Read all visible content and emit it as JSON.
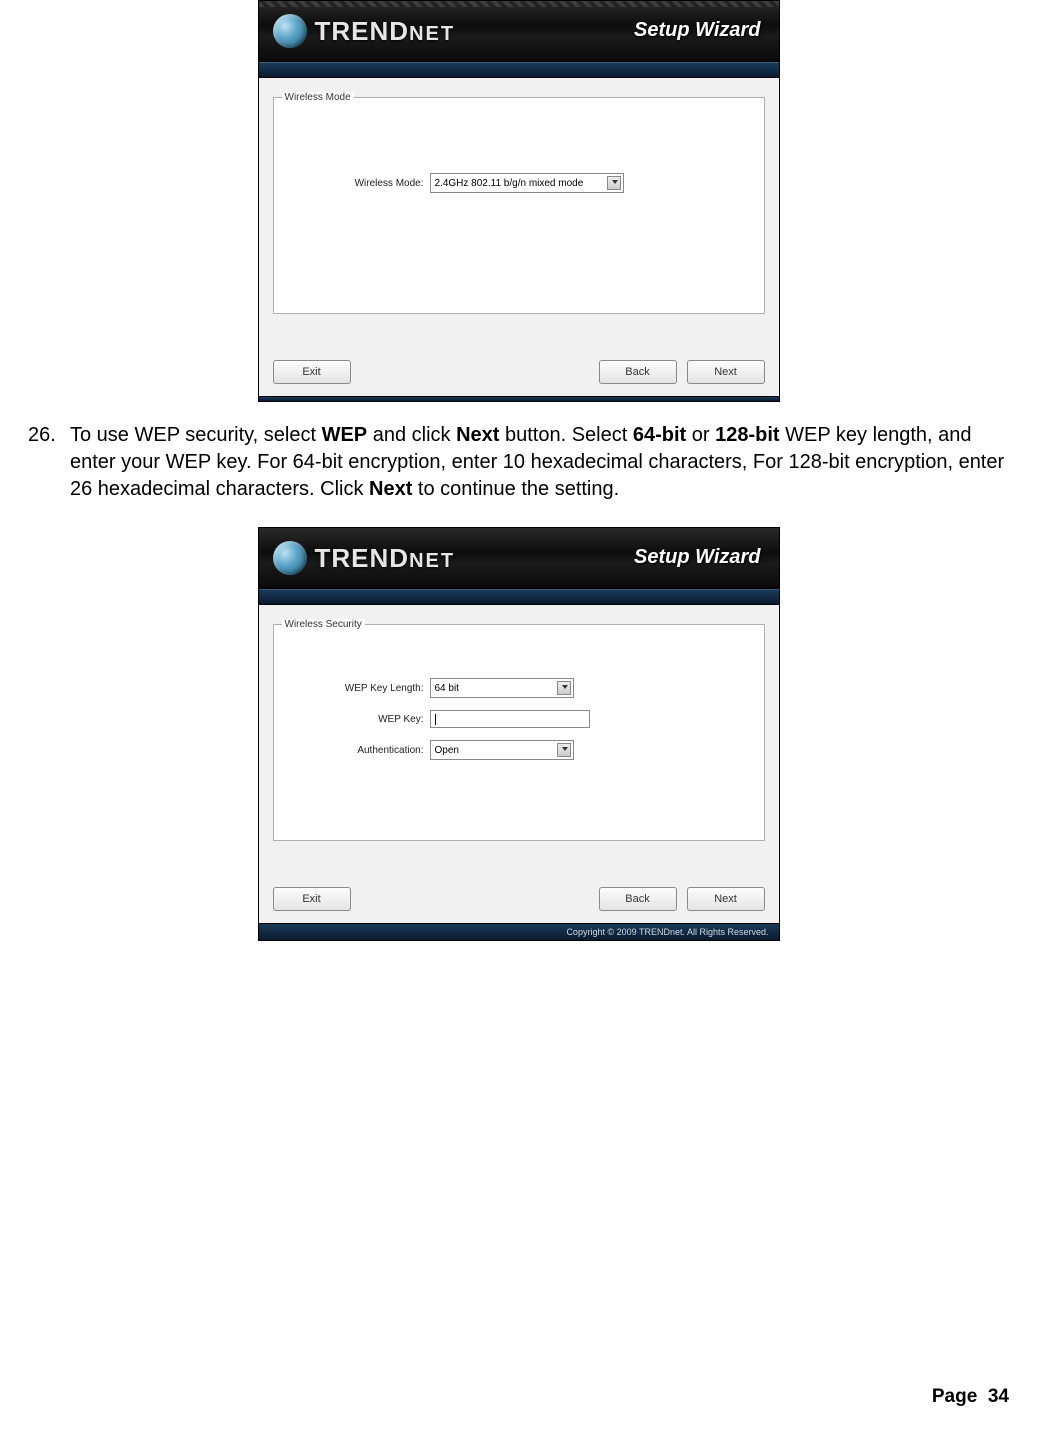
{
  "wizard_title": "Setup Wizard",
  "brand_main": "TREND",
  "brand_sub": "NET",
  "wiz1": {
    "group_title": "Wireless Mode",
    "mode_label": "Wireless Mode:",
    "mode_value": "2.4GHz 802.11 b/g/n mixed mode",
    "btn_exit": "Exit",
    "btn_back": "Back",
    "btn_next": "Next"
  },
  "instruction": {
    "number": "26.",
    "t1": "To use WEP security, select ",
    "b1": "WEP",
    "t2": " and click ",
    "b2": "Next",
    "t3": " button. Select ",
    "b3": "64-bit",
    "t4": " or ",
    "b4": "128-bit",
    "t5": " WEP key length, and enter your WEP key. For 64-bit encryption, enter 10 hexadecimal characters, For 128-bit encryption, enter 26 hexadecimal characters. Click ",
    "b5": "Next",
    "t6": " to continue the setting."
  },
  "wiz2": {
    "group_title": "Wireless Security",
    "len_label": "WEP Key Length:",
    "len_value": "64 bit",
    "key_label": "WEP Key:",
    "key_value": "",
    "auth_label": "Authentication:",
    "auth_value": "Open",
    "btn_exit": "Exit",
    "btn_back": "Back",
    "btn_next": "Next",
    "copyright": "Copyright © 2009 TRENDnet. All Rights Reserved."
  },
  "page_footer_label": "Page",
  "page_number": "34"
}
